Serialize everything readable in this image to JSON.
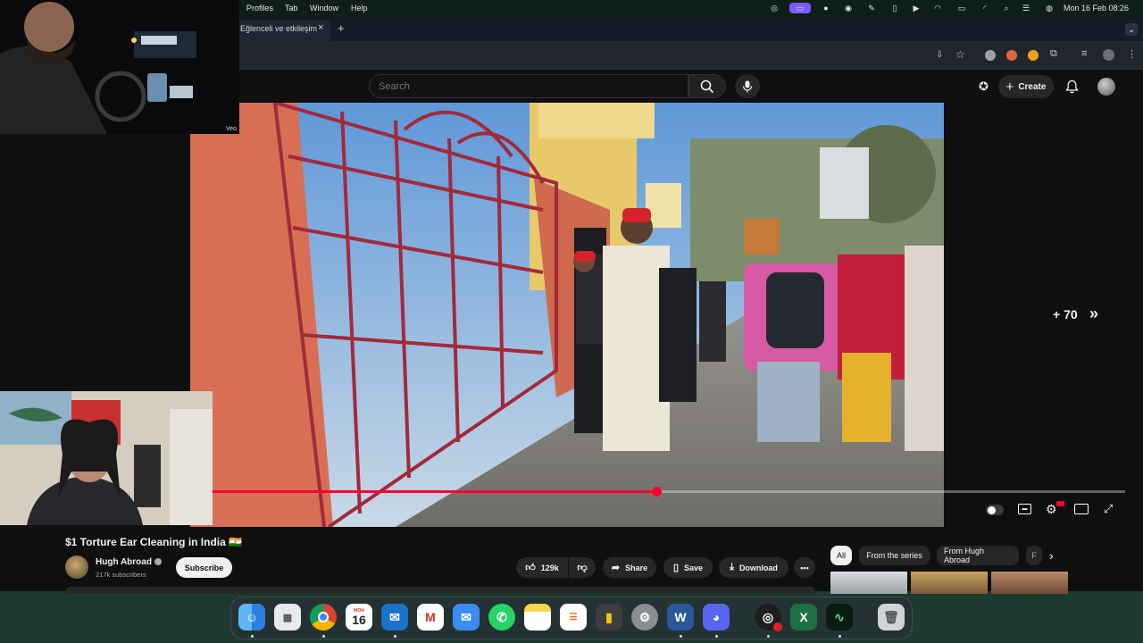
{
  "menubar": {
    "menus": [
      "Profiles",
      "Tab",
      "Window",
      "Help"
    ],
    "clock": "Mon 16 Feb  08:26"
  },
  "browser": {
    "tab_title": "Eğlenceli ve etkileşim",
    "tab_close": "×",
    "new_tab": "+"
  },
  "overlays": {
    "webcam_label": "Veo"
  },
  "youtube": {
    "search_placeholder": "Search",
    "create_label": "Create",
    "video": {
      "seek_label": "+ 70",
      "progress": 0.486
    },
    "title": "$1 Torture Ear Cleaning in India 🇮🇳",
    "channel": {
      "name": "Hugh Abroad",
      "subscribers": "217k subscribers",
      "subscribe_label": "Subscribe"
    },
    "actions": {
      "likes": "129k",
      "share": "Share",
      "save": "Save",
      "download": "Download",
      "more": "•••"
    },
    "chips": [
      "All",
      "From the series",
      "From Hugh Abroad",
      "F"
    ]
  },
  "dock": {
    "calendar_month": "MON",
    "calendar_day": "16"
  },
  "colors": {
    "accent_red": "#ff0033",
    "yt_background": "#0f0f0f"
  }
}
